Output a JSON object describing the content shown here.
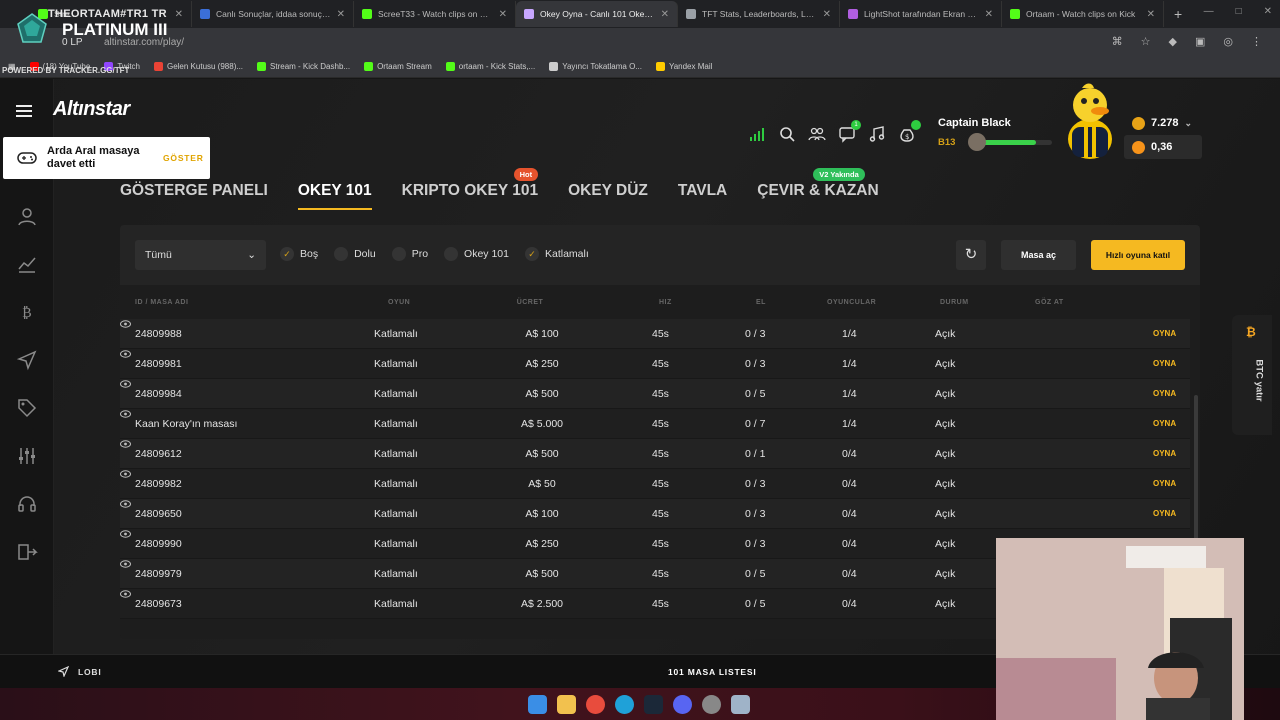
{
  "browser": {
    "tabs": [
      {
        "label": "Stre...",
        "color": "#53fc18",
        "active": false
      },
      {
        "label": "Canlı Sonuçlar, iddaa sonuçları",
        "color": "#3b6fd8",
        "active": false
      },
      {
        "label": "ScreeT33 - Watch clips on Kick",
        "color": "#53fc18",
        "active": false
      },
      {
        "label": "Okey Oyna - Canlı 101 Okey ve",
        "color": "#c7a6ff",
        "active": true
      },
      {
        "label": "TFT Stats, Leaderboards, League",
        "color": "#9aa0a6",
        "active": false
      },
      {
        "label": "LightShot tarafından Ekran Gör",
        "color": "#b05ee0",
        "active": false
      },
      {
        "label": "Ortaam - Watch clips on Kick",
        "color": "#53fc18",
        "active": false
      }
    ],
    "url": "altinstar.com/play/",
    "bookmarks": [
      {
        "label": "(18) YouTube",
        "color": "#ff0000"
      },
      {
        "label": "Twitch",
        "color": "#9146ff"
      },
      {
        "label": "Gelen Kutusu (988)...",
        "color": "#ea4335"
      },
      {
        "label": "Stream - Kick Dashb...",
        "color": "#53fc18"
      },
      {
        "label": "Ortaam Stream",
        "color": "#53fc18"
      },
      {
        "label": "ortaam - Kick Stats,...",
        "color": "#53fc18"
      },
      {
        "label": "Yayıncı Tokatlama O...",
        "color": "#cccccc"
      },
      {
        "label": "Yandex Mail",
        "color": "#ffcc00"
      }
    ]
  },
  "overlay": {
    "line1": "THEORTAAM#TR1 TR",
    "rank": "PLATINUM III",
    "lp": "0 LP",
    "powered": "POWERED BY TRACKER.GG/TFT"
  },
  "app": {
    "logo": "Altınstar",
    "invite": {
      "text": "Arda Aral masaya davet etti",
      "button": "GÖSTER"
    },
    "notification_count": "1",
    "user": {
      "name": "Captain Black",
      "level": "B13",
      "progress": 0.78
    },
    "wallet": {
      "gold": "7.278",
      "btc": "0,36"
    },
    "nav": [
      {
        "label": "GÖSTERGE PANELI",
        "active": false,
        "badge": ""
      },
      {
        "label": "OKEY 101",
        "active": true,
        "badge": ""
      },
      {
        "label": "KRIPTO OKEY 101",
        "active": false,
        "badge": "Hot"
      },
      {
        "label": "OKEY DÜZ",
        "active": false,
        "badge": ""
      },
      {
        "label": "TAVLA",
        "active": false,
        "badge": ""
      },
      {
        "label": "ÇEVIR & KAZAN",
        "active": false,
        "badge": "V2 Yakında"
      }
    ],
    "filters": {
      "select_value": "Tümü",
      "checks": [
        {
          "label": "Boş",
          "checked": true
        },
        {
          "label": "Dolu",
          "checked": false
        },
        {
          "label": "Pro",
          "checked": false
        },
        {
          "label": "Okey 101",
          "checked": false
        },
        {
          "label": "Katlamalı",
          "checked": true
        }
      ],
      "open_table": "Masa aç",
      "quick_join": "Hızlı oyuna katıl"
    },
    "table": {
      "headers": {
        "id": "ID / MASA ADI",
        "game": "OYUN",
        "fee": "ÜCRET",
        "speed": "HIZ",
        "hand": "EL",
        "players": "OYUNCULAR",
        "status": "DURUM",
        "watch": "GÖZ AT"
      },
      "rows": [
        {
          "id": "24809988",
          "game": "Katlamalı",
          "fee": "A$ 100",
          "speed": "45s",
          "hand": "0 / 3",
          "players": "1/4",
          "status": "Açık",
          "play": "OYNA"
        },
        {
          "id": "24809981",
          "game": "Katlamalı",
          "fee": "A$ 250",
          "speed": "45s",
          "hand": "0 / 3",
          "players": "1/4",
          "status": "Açık",
          "play": "OYNA"
        },
        {
          "id": "24809984",
          "game": "Katlamalı",
          "fee": "A$ 500",
          "speed": "45s",
          "hand": "0 / 5",
          "players": "1/4",
          "status": "Açık",
          "play": "OYNA"
        },
        {
          "id": "Kaan Koray'ın masası",
          "game": "Katlamalı",
          "fee": "A$ 5.000",
          "speed": "45s",
          "hand": "0 / 7",
          "players": "1/4",
          "status": "Açık",
          "play": "OYNA"
        },
        {
          "id": "24809612",
          "game": "Katlamalı",
          "fee": "A$ 500",
          "speed": "45s",
          "hand": "0 / 1",
          "players": "0/4",
          "status": "Açık",
          "play": "OYNA"
        },
        {
          "id": "24809982",
          "game": "Katlamalı",
          "fee": "A$ 50",
          "speed": "45s",
          "hand": "0 / 3",
          "players": "0/4",
          "status": "Açık",
          "play": "OYNA"
        },
        {
          "id": "24809650",
          "game": "Katlamalı",
          "fee": "A$ 100",
          "speed": "45s",
          "hand": "0 / 3",
          "players": "0/4",
          "status": "Açık",
          "play": "OYNA"
        },
        {
          "id": "24809990",
          "game": "Katlamalı",
          "fee": "A$ 250",
          "speed": "45s",
          "hand": "0 / 3",
          "players": "0/4",
          "status": "Açık",
          "play": ""
        },
        {
          "id": "24809979",
          "game": "Katlamalı",
          "fee": "A$ 500",
          "speed": "45s",
          "hand": "0 / 5",
          "players": "0/4",
          "status": "Açık",
          "play": ""
        },
        {
          "id": "24809673",
          "game": "Katlamalı",
          "fee": "A$ 2.500",
          "speed": "45s",
          "hand": "0 / 5",
          "players": "0/4",
          "status": "Açık",
          "play": ""
        }
      ]
    },
    "btc_tab": {
      "symbol": "₿",
      "label": "BTC yatır"
    },
    "footer": {
      "lobby": "LOBI",
      "list_title": "101 MASA LISTESI"
    }
  }
}
